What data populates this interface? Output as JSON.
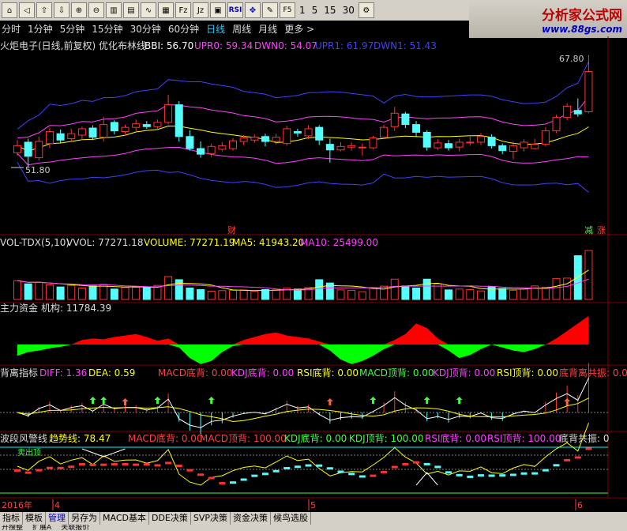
{
  "toolbar": {
    "icons": [
      "home-icon",
      "back-icon",
      "up-arrow-icon",
      "down-arrow-icon",
      "zoom-in-icon",
      "zoom-out-icon",
      "kline-icon",
      "period-icon",
      "minute-icon",
      "tick-icon",
      "fiz-icon",
      "jiz-icon",
      "layout-icon",
      "rsi-icon",
      "move-icon",
      "draw-icon",
      "f5-icon"
    ],
    "rsi_label": "RSI",
    "f5_label": "F5",
    "numbers": [
      "1",
      "5",
      "15",
      "30"
    ]
  },
  "logo": {
    "title": "分析家公式网",
    "url": "www.88gs.com"
  },
  "periods": [
    "分时",
    "1分钟",
    "5分钟",
    "15分钟",
    "30分钟",
    "60分钟",
    "日线",
    "周线",
    "月线",
    "更多 >"
  ],
  "active_period": "日线",
  "main_panel": {
    "title": "火炬电子(日线,前复权) 优化布林线",
    "bbi_label": "BBI: 56.70",
    "upr0_label": "UPR0: 59.34",
    "dwn0_label": "DWN0: 54.07",
    "upr1_label": "UPR1: 61.97",
    "dwn1_label": "DWN1: 51.43",
    "high_label": "67.80",
    "low_label": "51.80",
    "badge_cai": "财",
    "badge_jian": "减",
    "badge_zhang": "涨",
    "colors": {
      "bbi": "#ffffff",
      "upr0": "#ff40ff",
      "dwn0": "#ff40ff",
      "upr1": "#4040ff",
      "dwn1": "#4040ff",
      "mid": "#ffff00"
    }
  },
  "vol_panel": {
    "title": "VOL-TDX(5,10)",
    "vvol": "VVOL: 77271.18",
    "volume": "VOLUME: 77271.19",
    "ma5": "MA5: 41943.20",
    "ma10": "MA10: 25499.00"
  },
  "money_panel": {
    "title": "主力资金",
    "jigou": "机构: 11784.39"
  },
  "div_panel": {
    "title": "背离指标",
    "diff": "DIFF: 1.36",
    "dea": "DEA: 0.59",
    "macd_db": "MACD底背: 0.00",
    "kdj_db": "KDJ底背: 0.00",
    "rsi_db": "RSI底背: 0.00",
    "macd_dd": "MACD顶背: 0.00",
    "kdj_dd": "KDJ顶背: 0.00",
    "rsi_dd": "RSI顶背: 0.00",
    "gong": "底背离共振: 0.00"
  },
  "wave_panel": {
    "title": "波段风警线",
    "trend": "趋势线: 78.47",
    "macd_db": "MACD底背: 0.00",
    "macd_dd": "MACD顶背: 100.00",
    "kdj_db": "KDJ底背: 0.00",
    "kdj_dd": "KDJ顶背: 100.00",
    "rsi_db": "RSI底背: 0.00",
    "rsi_dd": "RSI顶背: 100.00",
    "gong": "底背共振: 0",
    "sell_marker": "卖出顶"
  },
  "date_axis": {
    "year": "2016年",
    "m4": "4",
    "m5": "5",
    "m6": "6"
  },
  "bottom_tabs": [
    "指标",
    "模板",
    "管理",
    "另存为",
    "MACD基本",
    "DDE决策",
    "SVP决策",
    "资金决策",
    "候鸟选股"
  ],
  "active_tab": "管理",
  "bottom_tabs2": [
    "开搜整",
    "扩展A",
    "关联报价"
  ],
  "chart_data": {
    "type": "candlestick",
    "candles": [
      {
        "o": 54.0,
        "c": 55.0,
        "h": 55.8,
        "l": 53.6
      },
      {
        "o": 55.5,
        "c": 53.5,
        "h": 56.0,
        "l": 52.0
      },
      {
        "o": 53.3,
        "c": 55.6,
        "h": 56.3,
        "l": 52.9
      },
      {
        "o": 55.3,
        "c": 57.0,
        "h": 57.5,
        "l": 54.7
      },
      {
        "o": 56.7,
        "c": 55.8,
        "h": 57.3,
        "l": 55.4
      },
      {
        "o": 56.0,
        "c": 56.7,
        "h": 57.4,
        "l": 55.5
      },
      {
        "o": 56.5,
        "c": 57.4,
        "h": 57.7,
        "l": 55.8
      },
      {
        "o": 57.5,
        "c": 56.2,
        "h": 57.9,
        "l": 55.8
      },
      {
        "o": 56.2,
        "c": 58.0,
        "h": 59.1,
        "l": 55.6
      },
      {
        "o": 58.3,
        "c": 57.1,
        "h": 58.6,
        "l": 56.6
      },
      {
        "o": 57.0,
        "c": 57.6,
        "h": 58.0,
        "l": 56.7
      },
      {
        "o": 57.6,
        "c": 58.1,
        "h": 58.7,
        "l": 57.1
      },
      {
        "o": 58.0,
        "c": 57.7,
        "h": 58.5,
        "l": 57.4
      },
      {
        "o": 57.7,
        "c": 58.3,
        "h": 58.7,
        "l": 57.3
      },
      {
        "o": 58.3,
        "c": 60.8,
        "h": 62.2,
        "l": 58.0
      },
      {
        "o": 60.8,
        "c": 56.3,
        "h": 61.3,
        "l": 55.6
      },
      {
        "o": 56.3,
        "c": 54.6,
        "h": 57.2,
        "l": 54.3
      },
      {
        "o": 54.6,
        "c": 53.8,
        "h": 55.6,
        "l": 53.3
      },
      {
        "o": 53.9,
        "c": 54.9,
        "h": 55.3,
        "l": 53.4
      },
      {
        "o": 54.5,
        "c": 55.0,
        "h": 55.5,
        "l": 54.2
      },
      {
        "o": 54.6,
        "c": 55.7,
        "h": 56.1,
        "l": 54.3
      },
      {
        "o": 55.6,
        "c": 56.1,
        "h": 56.5,
        "l": 55.1
      },
      {
        "o": 55.8,
        "c": 56.2,
        "h": 56.6,
        "l": 55.4
      },
      {
        "o": 56.3,
        "c": 55.6,
        "h": 56.7,
        "l": 54.9
      },
      {
        "o": 55.6,
        "c": 56.2,
        "h": 56.7,
        "l": 55.2
      },
      {
        "o": 55.3,
        "c": 57.4,
        "h": 57.8,
        "l": 55.0
      },
      {
        "o": 57.0,
        "c": 56.8,
        "h": 57.4,
        "l": 56.3
      },
      {
        "o": 56.4,
        "c": 57.4,
        "h": 57.9,
        "l": 55.9
      },
      {
        "o": 57.6,
        "c": 55.8,
        "h": 57.9,
        "l": 55.1
      },
      {
        "o": 55.2,
        "c": 54.4,
        "h": 56.0,
        "l": 52.6
      },
      {
        "o": 54.4,
        "c": 54.9,
        "h": 55.5,
        "l": 54.2
      },
      {
        "o": 54.8,
        "c": 55.0,
        "h": 55.5,
        "l": 54.3
      },
      {
        "o": 54.7,
        "c": 54.8,
        "h": 55.3,
        "l": 53.6
      },
      {
        "o": 54.7,
        "c": 56.1,
        "h": 56.4,
        "l": 54.5
      },
      {
        "o": 56.2,
        "c": 57.6,
        "h": 58.0,
        "l": 56.0
      },
      {
        "o": 57.7,
        "c": 59.6,
        "h": 60.5,
        "l": 57.1
      },
      {
        "o": 59.5,
        "c": 58.0,
        "h": 59.8,
        "l": 57.5
      },
      {
        "o": 58.0,
        "c": 56.9,
        "h": 58.5,
        "l": 56.2
      },
      {
        "o": 56.9,
        "c": 54.8,
        "h": 57.2,
        "l": 54.3
      },
      {
        "o": 54.7,
        "c": 55.4,
        "h": 55.9,
        "l": 54.4
      },
      {
        "o": 55.3,
        "c": 54.7,
        "h": 55.8,
        "l": 54.3
      },
      {
        "o": 54.8,
        "c": 55.5,
        "h": 56.0,
        "l": 54.2
      },
      {
        "o": 55.4,
        "c": 55.5,
        "h": 56.3,
        "l": 55.0
      },
      {
        "o": 55.5,
        "c": 56.3,
        "h": 56.8,
        "l": 55.1
      },
      {
        "o": 56.2,
        "c": 55.0,
        "h": 56.6,
        "l": 54.6
      },
      {
        "o": 55.0,
        "c": 54.3,
        "h": 55.3,
        "l": 53.8
      },
      {
        "o": 54.2,
        "c": 55.0,
        "h": 55.6,
        "l": 53.1
      },
      {
        "o": 54.7,
        "c": 55.5,
        "h": 55.9,
        "l": 54.2
      },
      {
        "o": 54.6,
        "c": 55.2,
        "h": 56.0,
        "l": 54.5
      },
      {
        "o": 55.2,
        "c": 57.1,
        "h": 57.6,
        "l": 54.9
      },
      {
        "o": 57.1,
        "c": 59.0,
        "h": 59.4,
        "l": 56.8
      },
      {
        "o": 59.0,
        "c": 60.6,
        "h": 61.0,
        "l": 58.6
      },
      {
        "o": 60.0,
        "c": 59.5,
        "h": 61.7,
        "l": 59.1
      },
      {
        "o": 59.8,
        "c": 65.5,
        "h": 67.8,
        "l": 59.6
      }
    ],
    "volume": [
      180,
      150,
      165,
      140,
      120,
      135,
      110,
      130,
      145,
      100,
      115,
      118,
      116,
      135,
      220,
      190,
      110,
      95,
      80,
      85,
      88,
      92,
      78,
      95,
      92,
      108,
      100,
      115,
      190,
      158,
      92,
      88,
      75,
      115,
      128,
      195,
      130,
      110,
      195,
      150,
      92,
      100,
      95,
      82,
      125,
      105,
      88,
      100,
      130,
      118,
      200,
      205,
      420,
      470
    ],
    "money": [
      -15,
      -10,
      -8,
      -5,
      -3,
      0,
      6,
      8,
      7,
      10,
      12,
      14,
      10,
      5,
      8,
      -4,
      -18,
      -26,
      -22,
      -10,
      -2,
      6,
      10,
      14,
      16,
      12,
      10,
      8,
      4,
      -8,
      -20,
      -26,
      -22,
      -15,
      -6,
      6,
      14,
      28,
      22,
      8,
      -8,
      -18,
      -14,
      -6,
      0,
      -4,
      -8,
      -10,
      -6,
      0,
      8,
      18,
      28,
      38
    ]
  }
}
